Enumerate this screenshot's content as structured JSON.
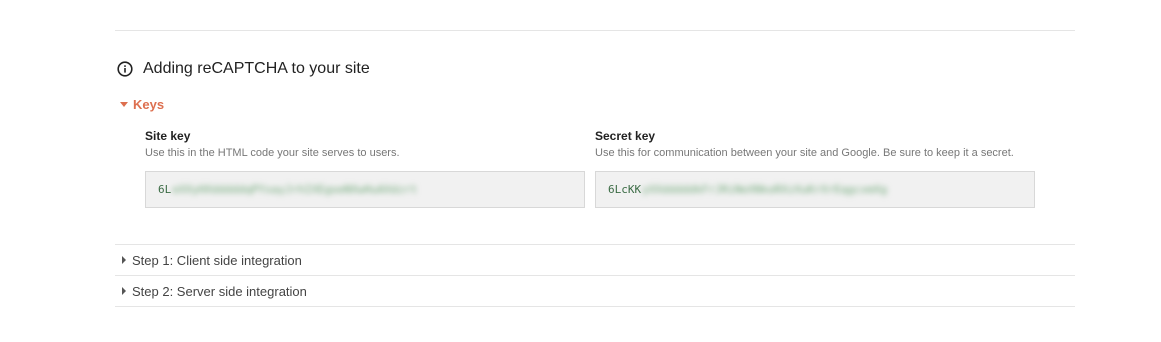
{
  "section": {
    "title": "Adding reCAPTCHA to your site",
    "icon": "info-icon"
  },
  "keys": {
    "toggle_label": "Keys",
    "accent_color": "#dd6f4f",
    "site": {
      "heading": "Site key",
      "description": "Use this in the HTML code your site serves to users.",
      "value_visible": "6L",
      "value_blurred": "eXXyHXdddddqPYxayJrhIXEgoeNXwHuAXdzrt"
    },
    "secret": {
      "heading": "Secret key",
      "description": "Use this for communication between your site and Google. Be sure to keep it a secret.",
      "value_visible": "6LcKK",
      "value_blurred": "yXXdddddkFrJRiNeXNkoRXzXuKrXrEqgcxmXg"
    }
  },
  "steps": [
    {
      "label": "Step 1: Client side integration"
    },
    {
      "label": "Step 2: Server side integration"
    }
  ]
}
